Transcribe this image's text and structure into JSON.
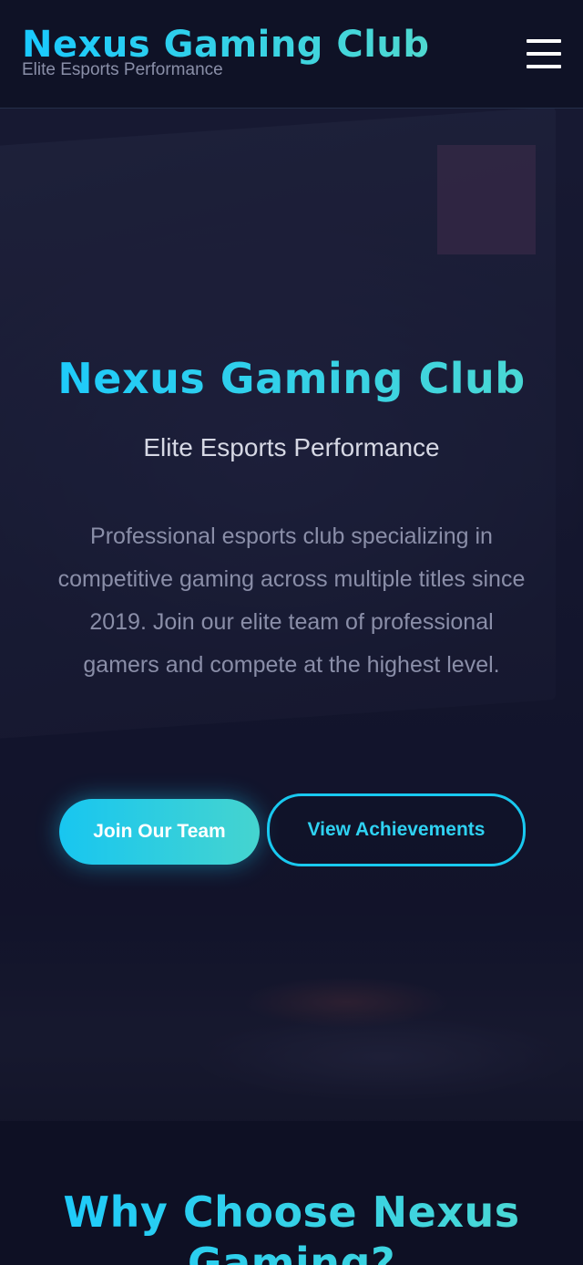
{
  "header": {
    "brand": "Nexus Gaming Club",
    "tagline": "Elite Esports Performance",
    "menu_icon": "hamburger-menu-icon"
  },
  "hero": {
    "title": "Nexus Gaming Club",
    "subtitle": "Elite Esports Performance",
    "description": "Professional esports club specializing in competitive gaming across multiple titles since 2019. Join our elite team of professional gamers and compete at the highest level.",
    "primary_button": "Join Our Team",
    "secondary_button": "View Achievements"
  },
  "why_section": {
    "title": "Why Choose Nexus Gaming?"
  },
  "colors": {
    "accent_start": "#19c9ff",
    "accent_end": "#4fd9d0",
    "background": "#0e1024",
    "header_bg": "#0f1226",
    "muted_text": "#8a8ea8"
  }
}
